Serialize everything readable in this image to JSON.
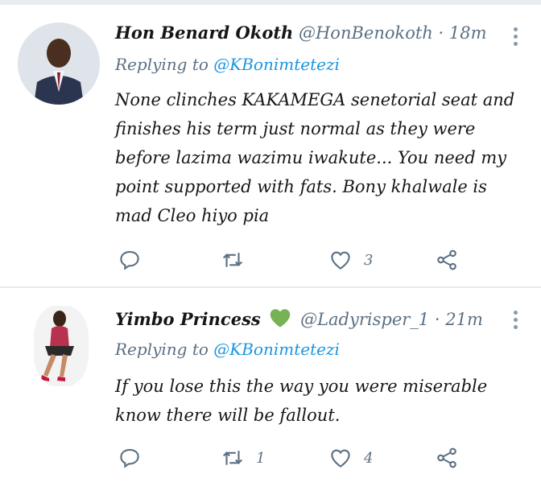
{
  "colors": {
    "accent": "#1b95e0",
    "muted": "#5b7083",
    "divider": "#e6ecf0",
    "heart_emoji": "#77b255"
  },
  "tweets": [
    {
      "name": "Hon Benard Okoth",
      "handle": "@HonBenokoth",
      "separator": "·",
      "time": "18m",
      "replying_prefix": "Replying to",
      "replying_to": "@KBonimtetezi",
      "text": "None clinches KAKAMEGA senetorial seat and finishes his term just normal as they were before lazima wazimu iwakute...  You need my point supported with fats.  Bony khalwale is mad  Cleo hiyo pia",
      "reply_count": "",
      "retweet_count": "",
      "like_count": "3",
      "icons": [
        "reply-icon",
        "retweet-icon",
        "heart-icon",
        "share-icon",
        "more-icon"
      ]
    },
    {
      "name": "Yimbo Princess",
      "name_emoji": "green-heart-icon",
      "handle": "@Ladyrisper_1",
      "separator": "·",
      "time": "21m",
      "replying_prefix": "Replying to",
      "replying_to": "@KBonimtetezi",
      "text": "If you lose this the way you were miserable know there will be fallout.",
      "reply_count": "",
      "retweet_count": "1",
      "like_count": "4",
      "icons": [
        "reply-icon",
        "retweet-icon",
        "heart-icon",
        "share-icon",
        "more-icon"
      ]
    }
  ]
}
